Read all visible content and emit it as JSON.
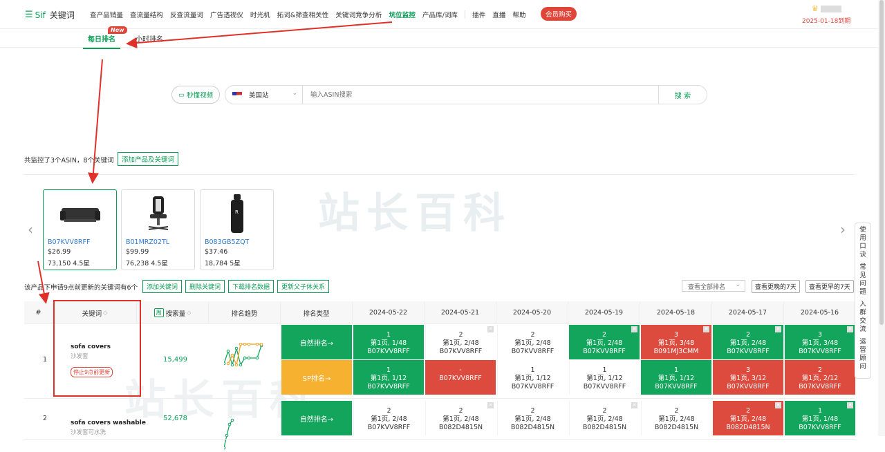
{
  "nav": {
    "logo": "Sif",
    "logo_sub": "关键词",
    "items": [
      {
        "label": "查产品销量",
        "active": false
      },
      {
        "label": "查流量结构",
        "active": false
      },
      {
        "label": "反查流量词",
        "active": false
      },
      {
        "label": "广告透视仪",
        "active": false
      },
      {
        "label": "时光机",
        "active": false
      },
      {
        "label": "拓词&筛查相关性",
        "active": false
      },
      {
        "label": "关键词竞争分析",
        "active": false
      },
      {
        "label": "坑位监控",
        "active": true
      },
      {
        "label": "产品库/词库",
        "active": false
      },
      {
        "label": "插件",
        "active": false
      },
      {
        "label": "直播",
        "active": false
      },
      {
        "label": "帮助",
        "active": false
      }
    ],
    "vip_button": "会员购买",
    "expire_date": "2025-01-18到期"
  },
  "subtabs": {
    "daily": "每日排名",
    "new_badge": "New",
    "hourly": "小时排名"
  },
  "search": {
    "video_button": "秒懂视频",
    "site": "美国站",
    "placeholder": "输入ASIN搜索",
    "button": "搜 索"
  },
  "summary": {
    "text": "共监控了3个ASIN，8个关键词",
    "add_button": "添加产品及关键词"
  },
  "products": [
    {
      "asin": "B07KVV8RFF",
      "price": "$26.99",
      "reviews": "73,150",
      "rating": "4.5星",
      "icon": "sofa-icon"
    },
    {
      "asin": "B01MRZ02TL",
      "price": "$99.99",
      "reviews": "76,238",
      "rating": "4.5星",
      "icon": "gaming-chair-icon"
    },
    {
      "asin": "B083GB5ZQT",
      "price": "$37.46",
      "reviews": "18,784",
      "rating": "5星",
      "icon": "water-bottle-icon"
    }
  ],
  "toolbar": {
    "desc": "该产品下申请9点前更新的关键词有6个",
    "buttons": [
      "添加关键词",
      "删除关键词",
      "下载排名数据",
      "更新父子体关系"
    ],
    "rank_select": "查看全部排名",
    "later_week": "查看更晚的7天",
    "earlier_week": "查看更早的7天"
  },
  "table": {
    "headers": {
      "index": "#",
      "keyword": "关键词",
      "week_toggle": "周",
      "volume": "搜索量",
      "trend": "排名趋势",
      "rank_type": "排名类型"
    },
    "dates": [
      "2024-05-22",
      "2024-05-21",
      "2024-05-20",
      "2024-05-19",
      "2024-05-18",
      "2024-05-17",
      "2024-05-16"
    ],
    "rows": [
      {
        "index": "1",
        "keyword": "sofa covers",
        "keyword_cn": "沙发套",
        "badge": "停止9点前更新",
        "volume": "15,499",
        "types": [
          {
            "label": "自然排名→",
            "color": "#14a55d",
            "cells": [
              {
                "rank": "1",
                "page": "第1页, 1/48",
                "asin": "B07KVV8RFF",
                "color": "green",
                "x": false
              },
              {
                "rank": "2",
                "page": "第1页, 2/48",
                "asin": "B07KVV8RFF",
                "color": "white",
                "x": true
              },
              {
                "rank": "2",
                "page": "第1页, 2/48",
                "asin": "B07KVV8RFF",
                "color": "white",
                "x": false
              },
              {
                "rank": "2",
                "page": "第1页, 2/48",
                "asin": "B07KVV8RFF",
                "color": "green",
                "x": true
              },
              {
                "rank": "3",
                "page": "第1页, 3/48",
                "asin": "B091MJ3CMM",
                "color": "red",
                "x": true
              },
              {
                "rank": "2",
                "page": "第1页, 2/48",
                "asin": "B07KVV8RFF",
                "color": "green",
                "x": true
              },
              {
                "rank": "3",
                "page": "第1页, 3/48",
                "asin": "B07KVV8RFF",
                "color": "green",
                "x": true
              }
            ]
          },
          {
            "label": "SP排名→",
            "color": "#f7b131",
            "cells": [
              {
                "rank": "1",
                "page": "第1页, 1/12",
                "asin": "B07KVV8RFF",
                "color": "green",
                "x": false
              },
              {
                "rank": "-",
                "page": "",
                "asin": "B07KVV8RFF",
                "color": "red",
                "x": false
              },
              {
                "rank": "1",
                "page": "第1页, 1/12",
                "asin": "B07KVV8RFF",
                "color": "white",
                "x": false
              },
              {
                "rank": "1",
                "page": "第1页, 1/12",
                "asin": "B07KVV8RFF",
                "color": "white",
                "x": false
              },
              {
                "rank": "1",
                "page": "第1页, 1/12",
                "asin": "B07KVV8RFF",
                "color": "green",
                "x": false
              },
              {
                "rank": "3",
                "page": "第1页, 3/12",
                "asin": "B07KVV8RFF",
                "color": "red",
                "x": false
              },
              {
                "rank": "2",
                "page": "第1页, 2/12",
                "asin": "B07KVV8RFF",
                "color": "red",
                "x": false
              }
            ]
          }
        ]
      },
      {
        "index": "2",
        "keyword": "sofa covers washable",
        "keyword_cn": "沙发套可水洗",
        "volume": "52,678",
        "types": [
          {
            "label": "自然排名→",
            "color": "#14a55d",
            "cells": [
              {
                "rank": "2",
                "page": "第1页, 2/48",
                "asin": "B07KVV8RFF",
                "color": "white",
                "x": false
              },
              {
                "rank": "2",
                "page": "第1页, 2/48",
                "asin": "B082D4815N",
                "color": "white",
                "x": true
              },
              {
                "rank": "2",
                "page": "第1页, 2/48",
                "asin": "B082D4815N",
                "color": "white",
                "x": false
              },
              {
                "rank": "2",
                "page": "第1页, 2/48",
                "asin": "B082D4815N",
                "color": "white",
                "x": true
              },
              {
                "rank": "2",
                "page": "第1页, 2/48",
                "asin": "B082D4815N",
                "color": "white",
                "x": false
              },
              {
                "rank": "2",
                "page": "第1页, 2/48",
                "asin": "B082D4815N",
                "color": "red",
                "x": true
              },
              {
                "rank": "1",
                "page": "第1页, 1/48",
                "asin": "B07KVV8RFF",
                "color": "green",
                "x": true
              }
            ]
          }
        ]
      }
    ]
  },
  "help": [
    "使",
    "用",
    "口",
    "诀",
    "",
    "常",
    "见",
    "问",
    "题",
    "",
    "入",
    "群",
    "交",
    "流",
    "",
    "运",
    "营",
    "顾",
    "问"
  ],
  "watermark": "站长百科"
}
